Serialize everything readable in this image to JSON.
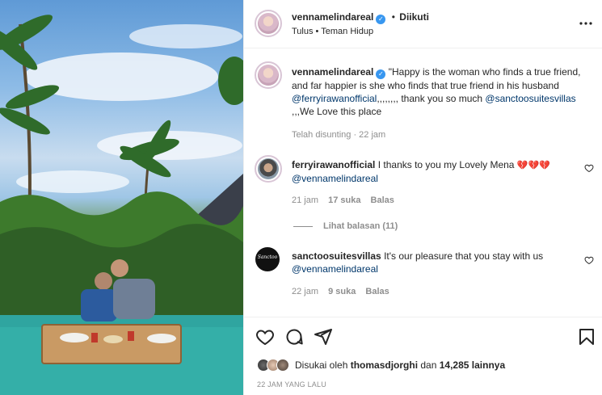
{
  "header": {
    "username": "vennamelindareal",
    "dot": "•",
    "follow_status": "Diikuti",
    "subtitle": "Tulus • Teman Hidup",
    "more_icon": "more-horizontal-icon"
  },
  "caption": {
    "username": "vennamelindareal",
    "text_1": "\"Happy is the woman who finds a true friend,",
    "text_2": "and far happier is she who finds that true friend in his husband",
    "mention_1": "@ferryirawanofficial",
    "text_3": ",,,,,,,, thank you so much ",
    "mention_2": "@sanctoosuitesvillas",
    "text_4": ",,,We Love this place",
    "edited": "Telah disunting · 22 jam"
  },
  "comments": [
    {
      "username": "ferryirawanofficial",
      "text": "I thanks to you my Lovely Mena",
      "emoji": "💔💔💔",
      "mention": "@vennamelindareal",
      "time": "21 jam",
      "likes": "17 suka",
      "reply": "Balas",
      "view_replies": "Lihat balasan (11)"
    },
    {
      "username": "sanctoosuitesvillas",
      "text": "It's our pleasure that you stay with us",
      "mention": "@vennamelindareal",
      "time": "22 jam",
      "likes": "9 suka",
      "reply": "Balas",
      "logo_text": "Sanctoo"
    }
  ],
  "actions": {
    "like_icon": "heart-icon",
    "comment_icon": "comment-icon",
    "share_icon": "paper-plane-icon",
    "save_icon": "bookmark-icon",
    "liked_by_prefix": "Disukai oleh ",
    "liked_by_user": "thomasdjorghi",
    "liked_by_middle": " dan ",
    "liked_by_count": "14,285 lainnya",
    "timestamp": "22 JAM YANG LALU"
  },
  "colors": {
    "verified": "#3897f0",
    "link": "#00376b",
    "muted": "#8e8e8e",
    "heart_emoji": "#e0245e"
  }
}
